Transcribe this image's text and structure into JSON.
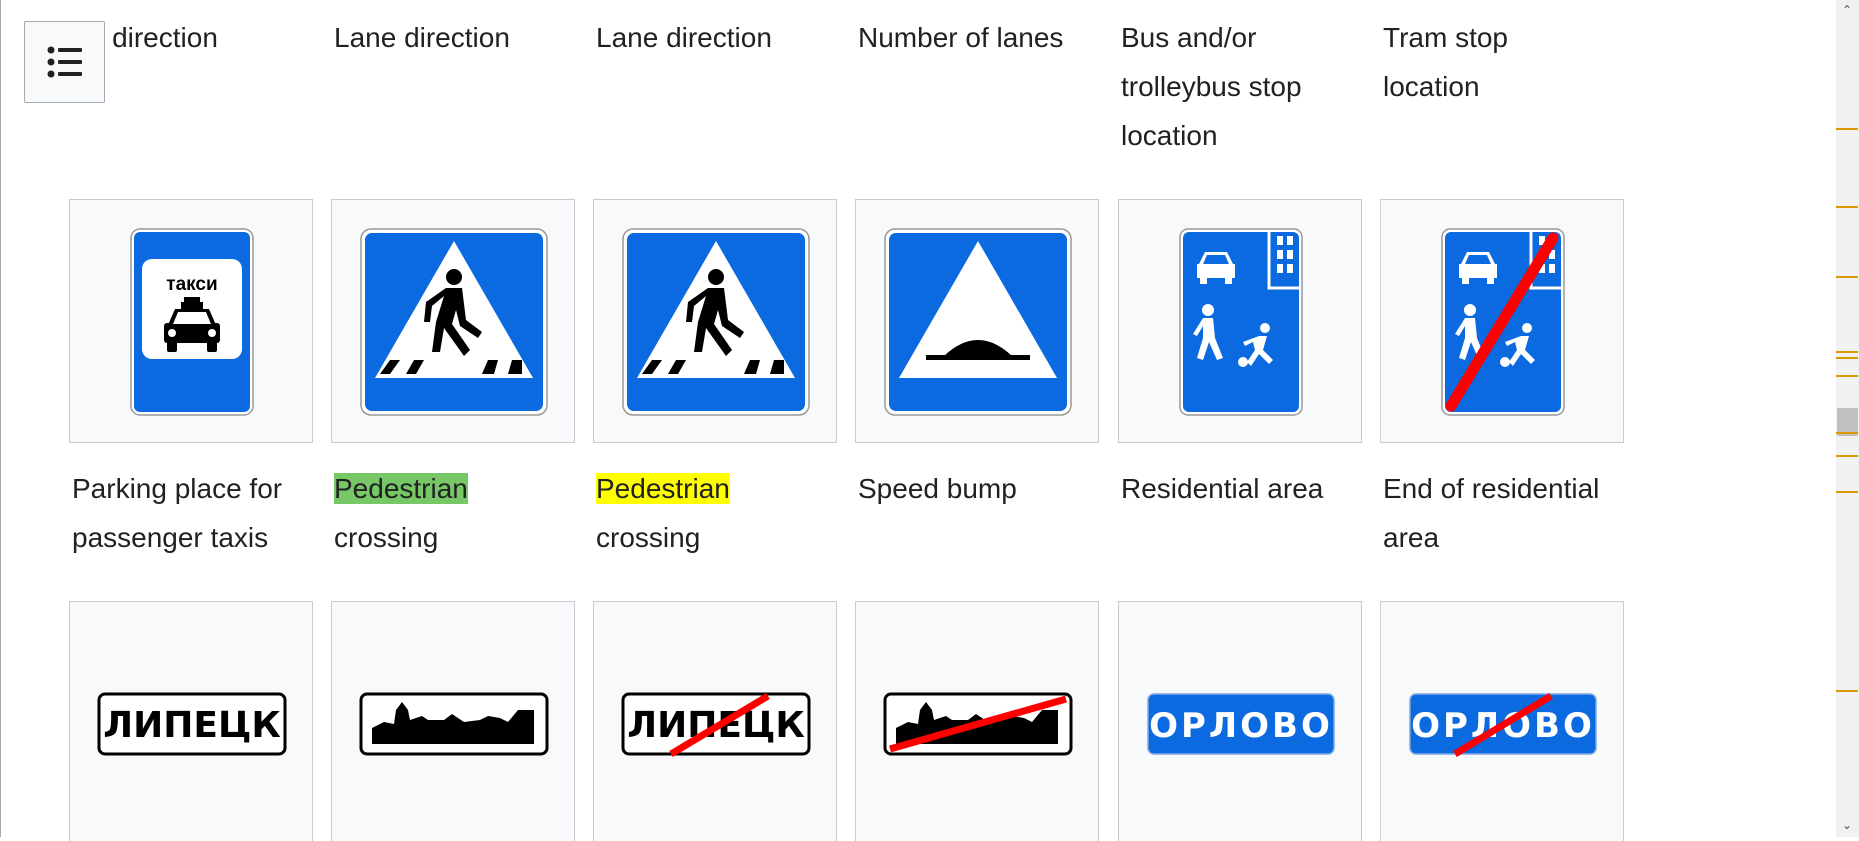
{
  "top_captions": [
    "Lane direction",
    "Lane direction",
    "Lane direction",
    "Number of lanes",
    "Bus and/or trolleybus stop location",
    "Tram stop location"
  ],
  "row2_captions": [
    {
      "first": "Parking place for passenger taxis",
      "rest": ""
    },
    {
      "first": "Pedestrian",
      "rest": " crossing"
    },
    {
      "first": "Pedestrian",
      "rest": " crossing"
    },
    {
      "first": "Speed bump",
      "rest": ""
    },
    {
      "first": "Residential area",
      "rest": ""
    },
    {
      "first": "End of residential area",
      "rest": ""
    }
  ],
  "signs": {
    "taxi_text": "такси",
    "city_name": "ЛИПЕЦК",
    "village_name": "ОРЛОВО"
  },
  "highlight_colors": {
    "green": "#77c766",
    "yellow": "#ffff00"
  },
  "sign_colors": {
    "blue": "#0b6adf",
    "red": "#ff0000"
  },
  "icons": {
    "toc_button": "table-of-contents-icon"
  }
}
